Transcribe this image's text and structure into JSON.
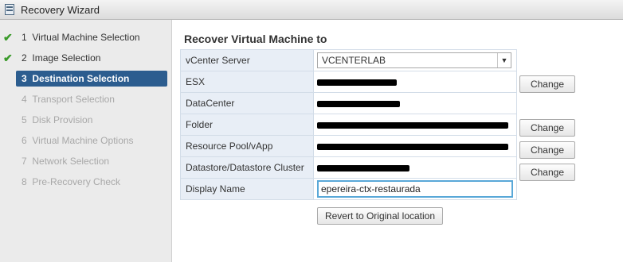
{
  "window": {
    "title": "Recovery Wizard",
    "icon": "wizard-icon"
  },
  "steps": [
    {
      "number": "1",
      "label": "Virtual Machine Selection",
      "state": "done"
    },
    {
      "number": "2",
      "label": "Image Selection",
      "state": "done"
    },
    {
      "number": "3",
      "label": "Destination Selection",
      "state": "active"
    },
    {
      "number": "4",
      "label": "Transport Selection",
      "state": "pending"
    },
    {
      "number": "5",
      "label": "Disk Provision",
      "state": "pending"
    },
    {
      "number": "6",
      "label": "Virtual Machine Options",
      "state": "pending"
    },
    {
      "number": "7",
      "label": "Network Selection",
      "state": "pending"
    },
    {
      "number": "8",
      "label": "Pre-Recovery Check",
      "state": "pending"
    }
  ],
  "check_glyph": "✔",
  "main": {
    "heading": "Recover Virtual Machine to",
    "fields": {
      "vcenter": {
        "label": "vCenter Server",
        "value": "VCENTERLAB"
      },
      "esx": {
        "label": "ESX",
        "change": "Change"
      },
      "datacenter": {
        "label": "DataCenter"
      },
      "folder": {
        "label": "Folder",
        "change": "Change"
      },
      "resource_pool": {
        "label": "Resource Pool/vApp",
        "change": "Change"
      },
      "datastore": {
        "label": "Datastore/Datastore Cluster",
        "change": "Change"
      },
      "display_name": {
        "label": "Display Name",
        "value": "epereira-ctx-restaurada"
      }
    },
    "revert_label": "Revert to Original location"
  },
  "colors": {
    "active_step": "#2c5d8f",
    "check": "#3a9a2a",
    "label_cell": "#e8eef6",
    "focus_border": "#59a8d8"
  }
}
